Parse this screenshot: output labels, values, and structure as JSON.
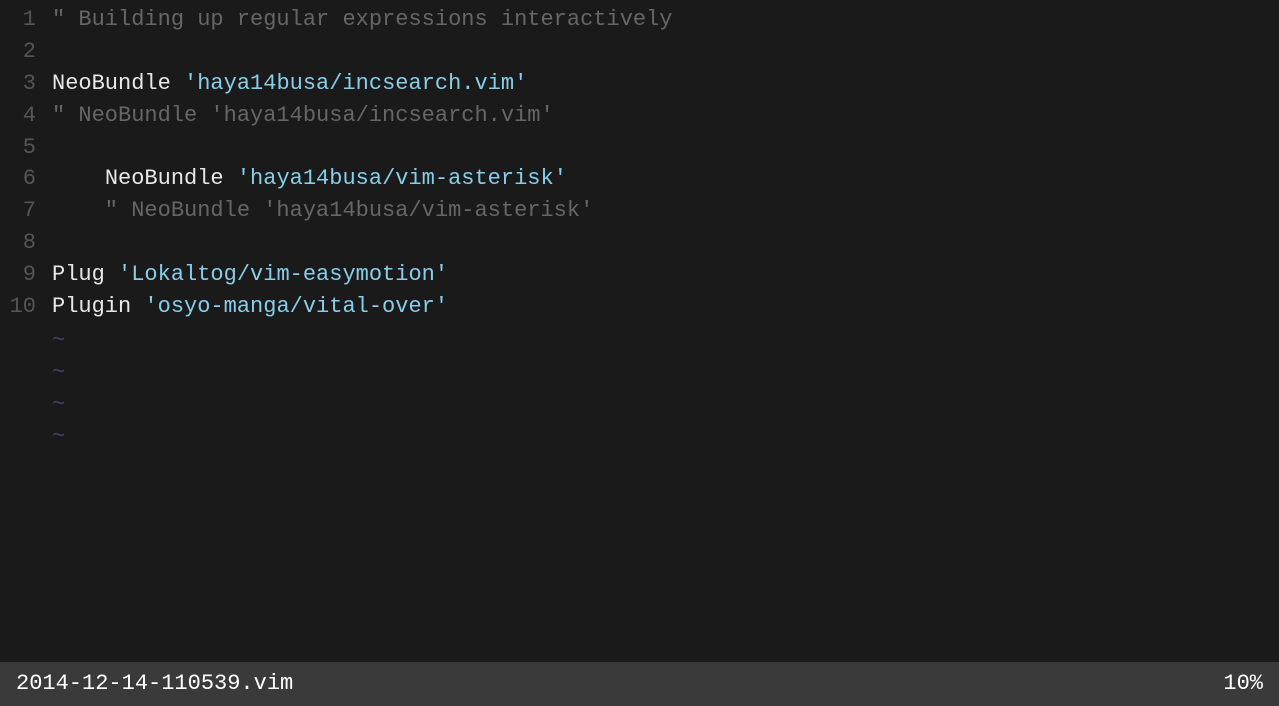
{
  "editor": {
    "lines": [
      {
        "num": "1",
        "parts": [
          {
            "text": "\" Building up regular expressions interactively",
            "class": "c-comment"
          }
        ]
      },
      {
        "num": "2",
        "parts": []
      },
      {
        "num": "3",
        "parts": [
          {
            "text": "NeoBundle",
            "class": "c-keyword"
          },
          {
            "text": " ",
            "class": ""
          },
          {
            "text": "'haya14busa/incsearch.vim'",
            "class": "c-string"
          }
        ]
      },
      {
        "num": "4",
        "parts": [
          {
            "text": "\" NeoBundle 'haya14busa/incsearch.vim'",
            "class": "c-comment"
          }
        ]
      },
      {
        "num": "5",
        "parts": []
      },
      {
        "num": "6",
        "parts": [
          {
            "text": "    NeoBundle",
            "class": "c-keyword"
          },
          {
            "text": " ",
            "class": ""
          },
          {
            "text": "'haya14busa/vim-asterisk'",
            "class": "c-string"
          }
        ]
      },
      {
        "num": "7",
        "parts": [
          {
            "text": "    \" NeoBundle 'haya14busa/vim-asterisk'",
            "class": "c-comment"
          }
        ]
      },
      {
        "num": "8",
        "parts": []
      },
      {
        "num": "9",
        "parts": [
          {
            "text": "Plug",
            "class": "c-keyword"
          },
          {
            "text": " ",
            "class": ""
          },
          {
            "text": "'Lokaltog/vim-easymotion'",
            "class": "c-string"
          }
        ]
      },
      {
        "num": "10",
        "parts": [
          {
            "text": "Plugin",
            "class": "c-keyword"
          },
          {
            "text": " ",
            "class": ""
          },
          {
            "text": "'osyo-manga/vital-over'",
            "class": "c-string"
          }
        ]
      }
    ],
    "tildes": [
      "~",
      "~",
      "~",
      "~"
    ],
    "status": {
      "filename": "2014-12-14-110539.vim",
      "percent": "10%"
    }
  }
}
